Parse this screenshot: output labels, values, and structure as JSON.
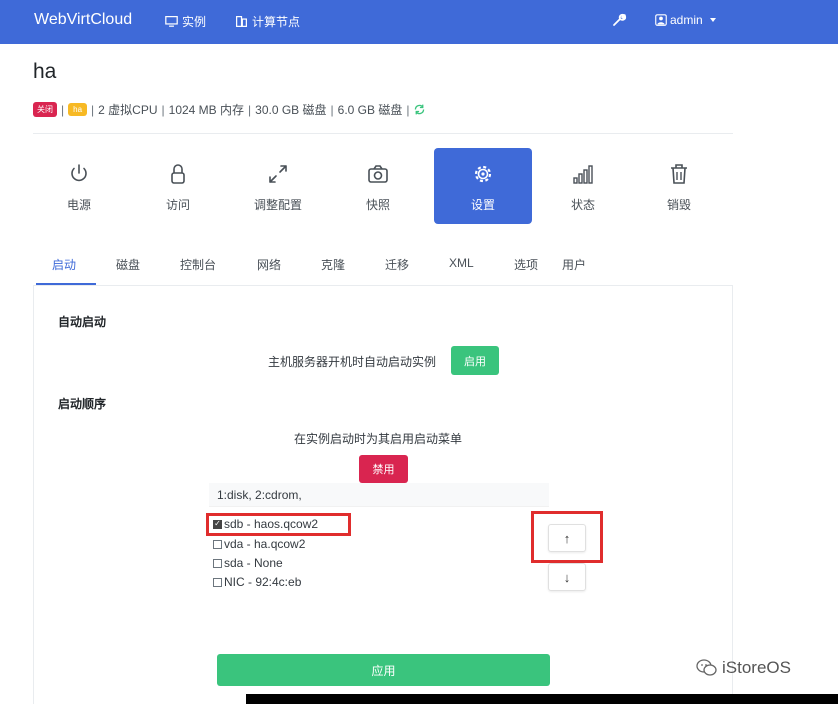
{
  "navbar": {
    "brand": "WebVirtCloud",
    "instances_label": "实例",
    "nodes_label": "计算节点",
    "user_label": "admin",
    "background_color": "#3f6ad8"
  },
  "instance": {
    "name": "ha",
    "status_badge": "关闭",
    "info_badge": "ha",
    "vcpu": "2 虚拟CPU",
    "memory": "1024 MB 内存",
    "disk1": "30.0 GB 磁盘",
    "disk2": "6.0 GB 磁盘"
  },
  "actions": [
    {
      "label": "电源",
      "icon": "power-icon"
    },
    {
      "label": "访问",
      "icon": "lock-icon"
    },
    {
      "label": "调整配置",
      "icon": "resize-icon"
    },
    {
      "label": "快照",
      "icon": "camera-icon"
    },
    {
      "label": "设置",
      "icon": "gear-icon"
    },
    {
      "label": "状态",
      "icon": "stats-icon"
    },
    {
      "label": "销毁",
      "icon": "trash-icon"
    }
  ],
  "tabs": [
    "启动",
    "磁盘",
    "控制台",
    "网络",
    "克隆",
    "迁移",
    "XML",
    "选项",
    "用户"
  ],
  "autostart": {
    "title": "自动启动",
    "description": "主机服务器开机时自动启动实例",
    "button": "启用"
  },
  "boot_order": {
    "title": "启动顺序",
    "description": "在实例启动时为其启用启动菜单",
    "button": "禁用",
    "current_order": "1:disk, 2:cdrom,",
    "devices": [
      {
        "label": "sdb - haos.qcow2",
        "checked": true
      },
      {
        "label": "vda - ha.qcow2",
        "checked": false
      },
      {
        "label": "sda - None",
        "checked": false
      },
      {
        "label": "NIC - 92:4c:eb",
        "checked": false
      }
    ],
    "up_label": "↑",
    "down_label": "↓",
    "save_button": "应用"
  },
  "watermark": "iStoreOS",
  "colors": {
    "primary": "#3f6ad8",
    "success": "#3ac47d",
    "danger": "#d92550",
    "warning": "#f7b924",
    "highlight": "#e02d2d"
  }
}
